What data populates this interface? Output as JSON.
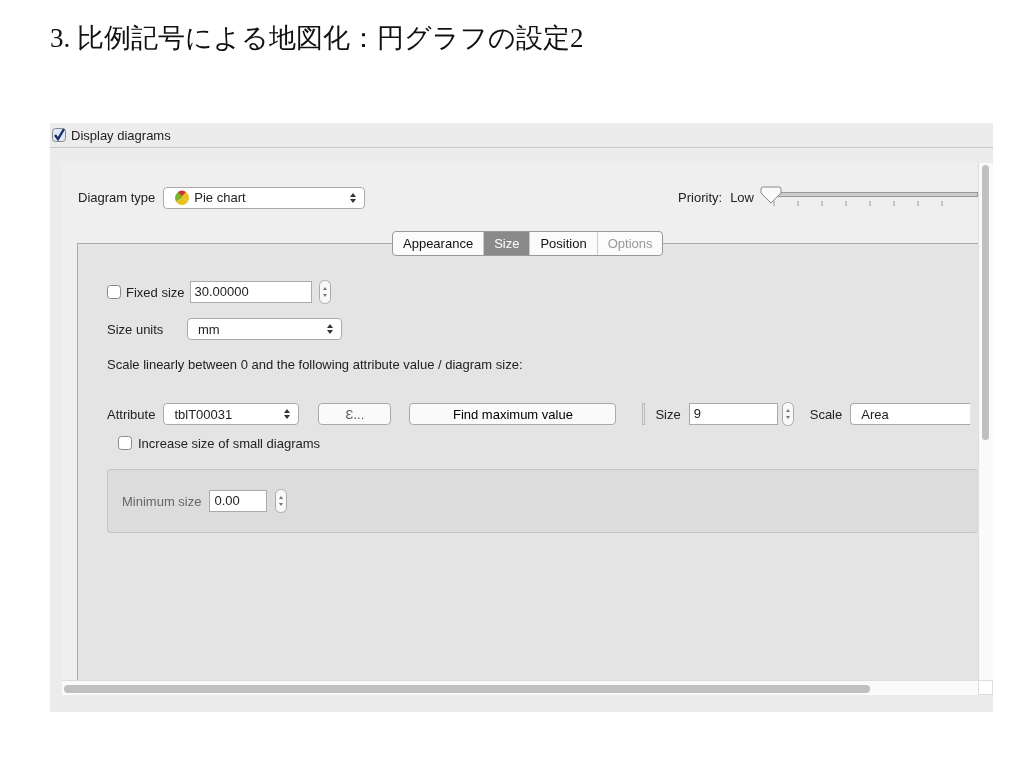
{
  "title": "3. 比例記号による地図化：円グラフの設定2",
  "display_diagrams": {
    "label": "Display diagrams",
    "checked": true
  },
  "diagram_type": {
    "label": "Diagram type",
    "value": "Pie chart"
  },
  "priority": {
    "label": "Priority:",
    "value_label": "Low",
    "level": 0
  },
  "tabs": [
    {
      "label": "Appearance",
      "selected": false,
      "disabled": false
    },
    {
      "label": "Size",
      "selected": true,
      "disabled": false
    },
    {
      "label": "Position",
      "selected": false,
      "disabled": false
    },
    {
      "label": "Options",
      "selected": false,
      "disabled": true
    }
  ],
  "fixed_size": {
    "label": "Fixed size",
    "checked": false,
    "value": "30.00000"
  },
  "size_units": {
    "label": "Size units",
    "value": "mm"
  },
  "scale_description": "Scale linearly between 0 and the following attribute value / diagram size:",
  "attribute": {
    "label": "Attribute",
    "value": "tblT00031",
    "expression_button": "Ɛ...",
    "find_button": "Find maximum value",
    "size_label": "Size",
    "size_value": "9",
    "scale_label": "Scale",
    "scale_value": "Area"
  },
  "increase_small": {
    "label": "Increase size of small diagrams",
    "checked": false
  },
  "minimum_size": {
    "label": "Minimum size",
    "value": "0.00",
    "disabled": true
  }
}
